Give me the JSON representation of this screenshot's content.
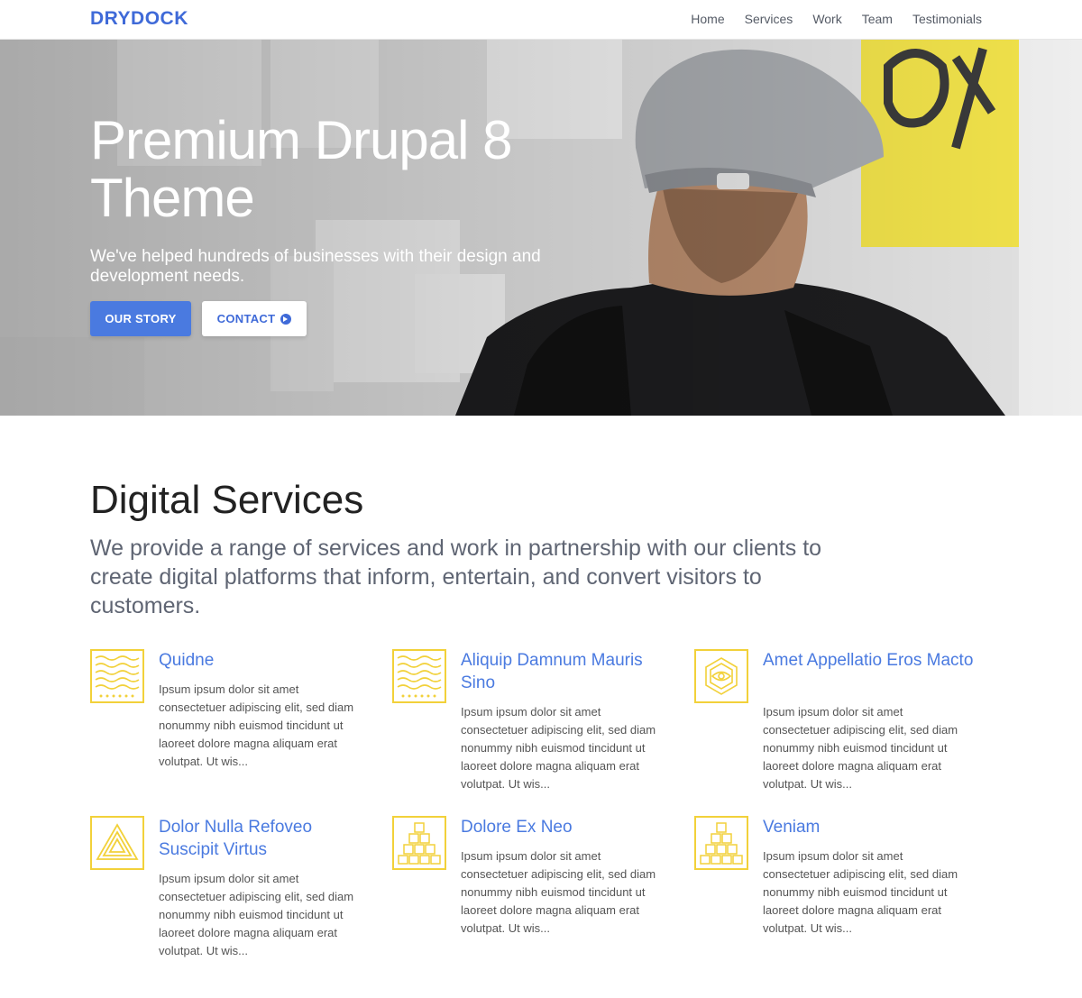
{
  "header": {
    "logo": "DRYDOCK",
    "nav": [
      "Home",
      "Services",
      "Work",
      "Team",
      "Testimonials"
    ]
  },
  "hero": {
    "title": "Premium Drupal 8 Theme",
    "subtitle": "We've helped hundreds of businesses with their design and development needs.",
    "primary_button": "OUR STORY",
    "secondary_button": "CONTACT"
  },
  "services": {
    "title": "Digital Services",
    "intro": "We provide a range of services and work in partnership with our clients to create digital platforms that inform, entertain, and convert visitors to customers.",
    "items": [
      {
        "title": "Quidne",
        "body": "Ipsum ipsum dolor sit amet consectetuer adipiscing elit, sed diam nonummy nibh euismod tincidunt ut laoreet dolore magna aliquam erat volutpat. Ut wis...",
        "icon": "waves-icon"
      },
      {
        "title": "Aliquip Damnum Mauris Sino",
        "body": "Ipsum ipsum dolor sit amet consectetuer adipiscing elit, sed diam nonummy nibh euismod tincidunt ut laoreet dolore magna aliquam erat volutpat. Ut wis...",
        "icon": "waves-icon"
      },
      {
        "title": "Amet Appellatio Eros Macto",
        "body": "Ipsum ipsum dolor sit amet consectetuer adipiscing elit, sed diam nonummy nibh euismod tincidunt ut laoreet dolore magna aliquam erat volutpat. Ut wis...",
        "icon": "eye-hexagon-icon"
      },
      {
        "title": "Dolor Nulla Refoveo Suscipit Virtus",
        "body": "Ipsum ipsum dolor sit amet consectetuer adipiscing elit, sed diam nonummy nibh euismod tincidunt ut laoreet dolore magna aliquam erat volutpat. Ut wis...",
        "icon": "triangle-icon"
      },
      {
        "title": "Dolore Ex Neo",
        "body": "Ipsum ipsum dolor sit amet consectetuer adipiscing elit, sed diam nonummy nibh euismod tincidunt ut laoreet dolore magna aliquam erat volutpat. Ut wis...",
        "icon": "cubes-icon"
      },
      {
        "title": "Veniam",
        "body": "Ipsum ipsum dolor sit amet consectetuer adipiscing elit, sed diam nonummy nibh euismod tincidunt ut laoreet dolore magna aliquam erat volutpat. Ut wis...",
        "icon": "cubes-icon"
      }
    ]
  },
  "colors": {
    "brand": "#3f6ad8",
    "link": "#4a7ae0",
    "icon_accent": "#f2d13a"
  }
}
